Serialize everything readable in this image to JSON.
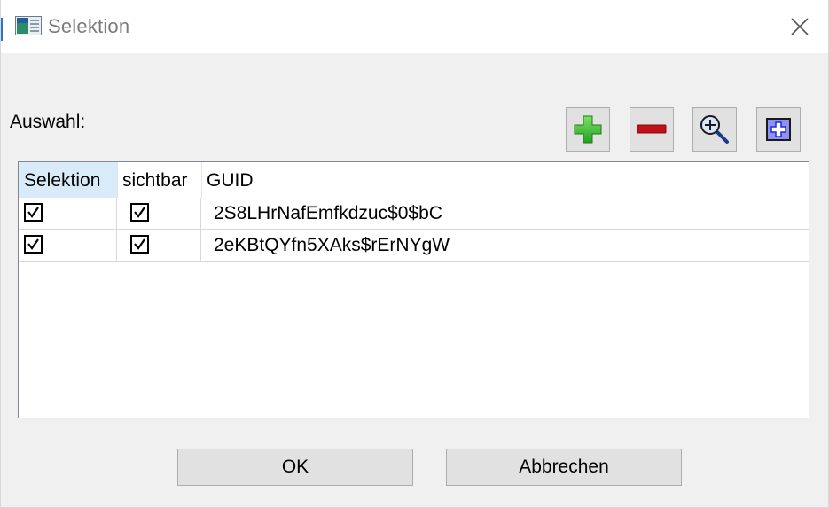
{
  "window": {
    "title": "Selektion"
  },
  "section": {
    "label": "Auswahl:"
  },
  "toolbar": {
    "buttons": [
      {
        "name": "add",
        "icon": "green-plus-icon"
      },
      {
        "name": "remove",
        "icon": "red-minus-icon"
      },
      {
        "name": "zoom",
        "icon": "magnifier-icon"
      },
      {
        "name": "add-element",
        "icon": "blue-plus-box-icon"
      }
    ]
  },
  "grid": {
    "columns": [
      "Selektion",
      "sichtbar",
      "GUID"
    ],
    "rows": [
      {
        "selected": true,
        "visible": true,
        "guid": "2S8LHrNafEmfkdzuc$0$bC"
      },
      {
        "selected": true,
        "visible": true,
        "guid": "2eKBtQYfn5XAks$rErNYgW"
      }
    ]
  },
  "buttons": {
    "ok": "OK",
    "cancel": "Abbrechen"
  },
  "colors": {
    "header_selected": "#d9ebf9",
    "window_bg": "#f0f0f0",
    "accent": "#2a73c9"
  }
}
